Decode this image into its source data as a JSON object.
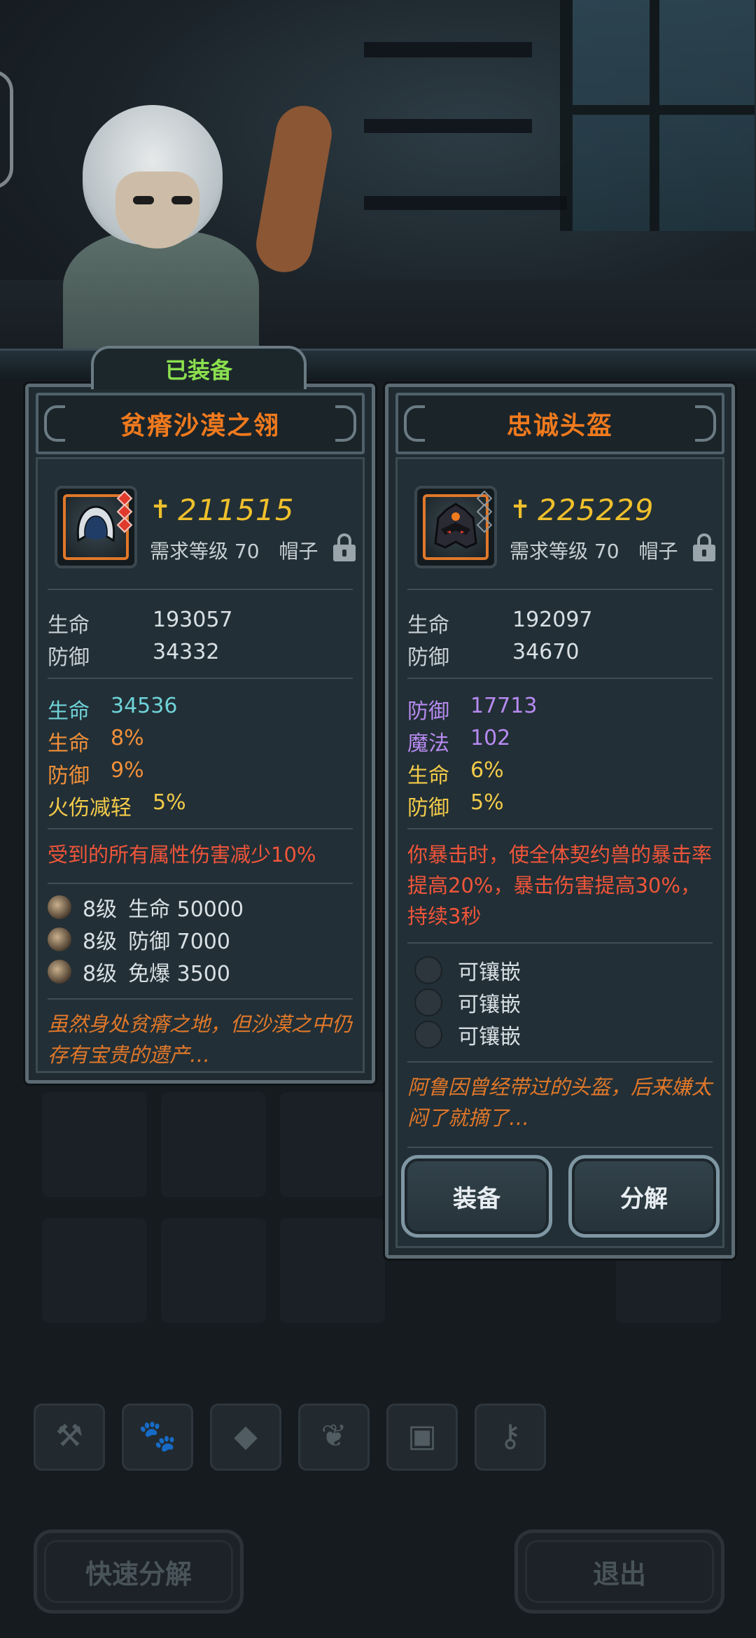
{
  "equipped_tab": "已装备",
  "equipped_item": {
    "name": "贫瘠沙漠之翎",
    "power": "211515",
    "req_level": "需求等级 70",
    "slot": "帽子",
    "base_stats": [
      {
        "label": "生命",
        "value": "193057"
      },
      {
        "label": "防御",
        "value": "34332"
      }
    ],
    "extra_stats": [
      {
        "label": "生命",
        "value": "34536",
        "color": "#6fd2d8"
      },
      {
        "label": "生命",
        "value": "8%",
        "color": "#f0903a"
      },
      {
        "label": "防御",
        "value": "9%",
        "color": "#f0903a"
      },
      {
        "label": "火伤减轻",
        "value": "5%",
        "color": "#f3cb4a"
      }
    ],
    "special": "受到的所有属性伤害减少10%",
    "gems": [
      {
        "level": "8级",
        "text": "生命 50000"
      },
      {
        "level": "8级",
        "text": "防御 7000"
      },
      {
        "level": "8级",
        "text": "免爆 3500"
      }
    ],
    "flavor": "虽然身处贫瘠之地，但沙漠之中仍存有宝贵的遗产…"
  },
  "new_item": {
    "name": "忠诚头盔",
    "power": "225229",
    "req_level": "需求等级 70",
    "slot": "帽子",
    "base_stats": [
      {
        "label": "生命",
        "value": "192097"
      },
      {
        "label": "防御",
        "value": "34670"
      }
    ],
    "extra_stats": [
      {
        "label": "防御",
        "value": "17713",
        "color": "#b78af0"
      },
      {
        "label": "魔法",
        "value": "102",
        "color": "#b78af0"
      },
      {
        "label": "生命",
        "value": "6%",
        "color": "#f3cb4a"
      },
      {
        "label": "防御",
        "value": "5%",
        "color": "#f3cb4a"
      }
    ],
    "special": "你暴击时，使全体契约兽的暴击率提高20%，暴击伤害提高30%，持续3秒",
    "sockets": [
      "可镶嵌",
      "可镶嵌",
      "可镶嵌"
    ],
    "flavor": "阿鲁因曾经带过的头盔，后来嫌太闷了就摘了…",
    "equip_button": "装备",
    "dismantle_button": "分解"
  },
  "bottom": {
    "quick_dismantle": "快速分解",
    "exit": "退出",
    "filter_icons": [
      "weapon-icon",
      "paw-icon",
      "gem-icon",
      "leaf-icon",
      "chest-icon",
      "key-icon"
    ]
  }
}
